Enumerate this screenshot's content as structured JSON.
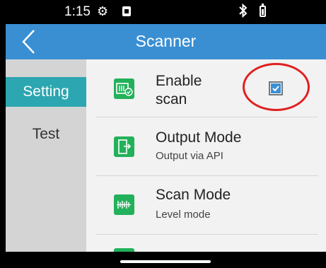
{
  "status_bar": {
    "time": "1:15",
    "icons": [
      "gear-icon",
      "sdcard-icon",
      "bluetooth-icon",
      "battery-icon"
    ]
  },
  "app_bar": {
    "back_icon": "chevron-left-icon",
    "title": "Scanner",
    "color": "#3a8fd3"
  },
  "sidebar": {
    "items": [
      {
        "label": "Setting",
        "active": true
      },
      {
        "label": "Test",
        "active": false
      }
    ],
    "active_color": "#2ca6b0"
  },
  "settings": [
    {
      "label_line1": "Enable",
      "label_line2": "scan",
      "icon": "scan-enable-icon",
      "checked": true
    },
    {
      "label": "Output Mode",
      "sublabel": "Output via API",
      "icon": "output-mode-icon"
    },
    {
      "label": "Scan Mode",
      "sublabel": "Level mode",
      "icon": "scan-mode-icon"
    }
  ],
  "colors": {
    "icon_green": "#22b15a",
    "highlight_red": "#e02020"
  }
}
